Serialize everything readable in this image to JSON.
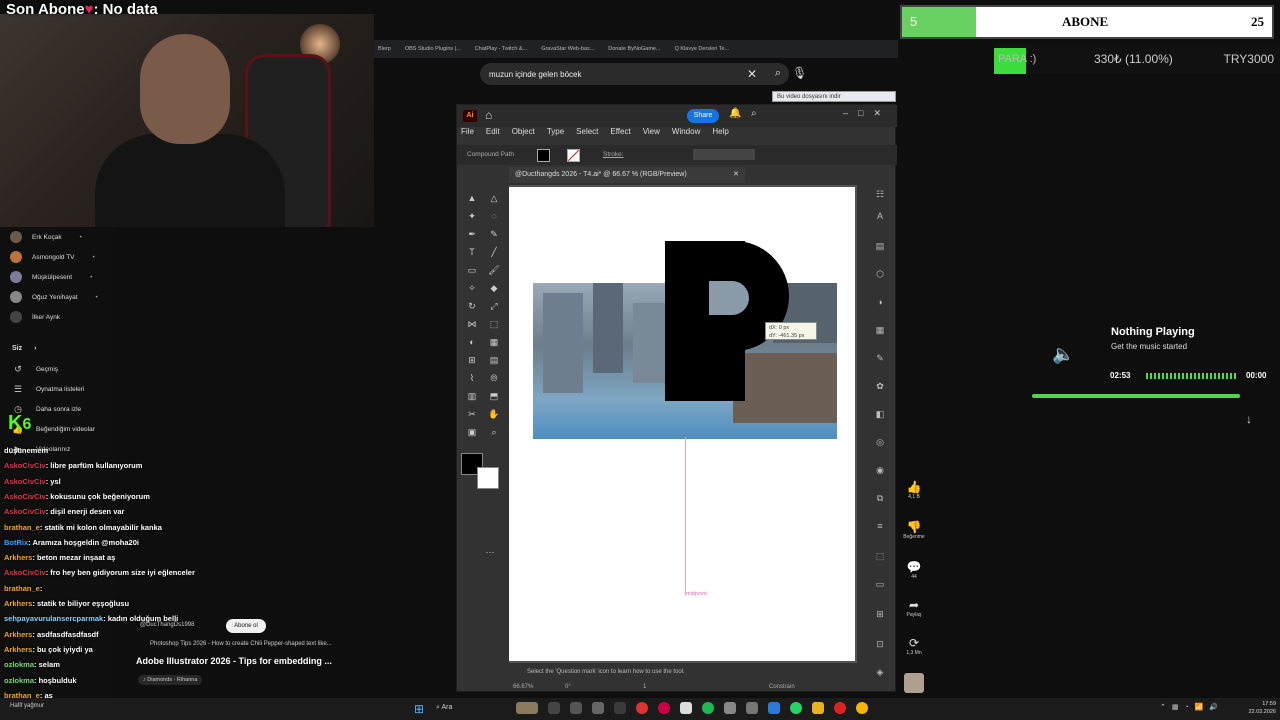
{
  "stream": {
    "title_prefix": "Son Abone",
    "title_suffix": ": No data",
    "sub_goal": {
      "current": "5",
      "label": "ABONE",
      "target": "25",
      "progress": 0.2
    },
    "para": {
      "tag": "PARA :)",
      "value": "330₺ (11.00%)",
      "try": "TRY3000"
    }
  },
  "browser": {
    "bookmarks": [
      "Blerp",
      "OBS Studio Plugins |...",
      "ChatPlay - Twitch &...",
      "GravaStar Web-bas...",
      "Donate ByNoGame...",
      "Q Klavye Dersleri Te..."
    ],
    "search_query": "muzun içinde gelen böcek",
    "download_banner": "Bu video dosyasını indir"
  },
  "sidebar": {
    "subscriptions": [
      "Erk Koçak",
      "Asmongold TV",
      "Müşkülpesent",
      "Oğuz Yenihayat",
      "İlker Aynk"
    ],
    "you_label": "Siz",
    "nav": [
      "Geçmiş",
      "Oynatma listeleri",
      "Daha sonra izle",
      "Beğendiğim videolar",
      "Videolarınız"
    ],
    "k_logo": "K",
    "k_number": "6"
  },
  "chat": [
    {
      "user": "düşünemem",
      "msg": "",
      "color": "#ffffff"
    },
    {
      "user": "AskoCivCiv",
      "msg": ": libre parfüm kullanıyorum",
      "color": "#e8344a"
    },
    {
      "user": "AskoCivCiv",
      "msg": ": ysl",
      "color": "#e8344a"
    },
    {
      "user": "AskoCivCiv",
      "msg": ": kokusunu çok beğeniyorum",
      "color": "#e8344a"
    },
    {
      "user": "AskoCivCiv",
      "msg": ": dişil enerji desen var",
      "color": "#e8344a"
    },
    {
      "user": "brathan_e",
      "msg": ": statik mi kolon olmayabilir kanka",
      "color": "#f5a623"
    },
    {
      "user": "BotRix",
      "msg": ": Aramıza hoşgeldin @moha20i",
      "color": "#3da5ff"
    },
    {
      "user": "Arkhers",
      "msg": ": beton mezar inşaat aş",
      "color": "#f5a623"
    },
    {
      "user": "AskoCivCiv",
      "msg": ": fro hey ben gidiyorum size iyi eğlenceler",
      "color": "#e8344a"
    },
    {
      "user": "brathan_e",
      "msg": ":",
      "color": "#f5a623"
    },
    {
      "user": "Arkhers",
      "msg": ": statik te biliyor eşşoğlusu",
      "color": "#f5a623"
    },
    {
      "user": "sehpayavurulansercparmak",
      "msg": ": kadın olduğum belli",
      "color": "#7fd4ff"
    },
    {
      "user": "Arkhers",
      "msg": ": asdfasdfasdfasdf",
      "color": "#f5a623"
    },
    {
      "user": "Arkhers",
      "msg": ": bu çok iyiydi ya",
      "color": "#f5a623"
    },
    {
      "user": "ozlokma",
      "msg": ": selam",
      "color": "#6fe06f"
    },
    {
      "user": "ozlokma",
      "msg": ": hoşbulduk",
      "color": "#6fe06f"
    },
    {
      "user": "brathan_e",
      "msg": ": as",
      "color": "#f5a623"
    },
    {
      "user": "brathan_e",
      "msg": ":",
      "color": "#f5a623"
    }
  ],
  "youtube": {
    "channel": "@DucThangDs1998",
    "subscribe": "Abone ol",
    "video_line": "Photoshop Tips 2026 - How to create Chili Pepper-shaped text like...",
    "title": "Adobe Illustrator 2026 - Tips for embedding ...",
    "music": "Diamonds · Rihanna",
    "likes": "4,1 B",
    "dislike_label": "Beğenme",
    "comments": "44",
    "share_label": "Paylaş",
    "remix_count": "1,3 Mn"
  },
  "illustrator": {
    "logo": "Ai",
    "share": "Share",
    "menu": [
      "File",
      "Edit",
      "Object",
      "Type",
      "Select",
      "Effect",
      "View",
      "Window",
      "Help"
    ],
    "control_label": "Compound Path",
    "stroke_label": "Stroke:",
    "doc_tab": "@Ducthangds 2026 - T4.ai* @ 66.67 % (RGB/Preview)",
    "tooltip_dx": "dX: 0 px",
    "tooltip_dy": "dY: -461.35 px",
    "midpoint": "midpoint",
    "status": "Select the 'Question mark' icon to learn how to use the tool.",
    "zoom": "66.67%",
    "angle": "0°",
    "page": "1",
    "constrain": "Constrain"
  },
  "music": {
    "title": "Nothing Playing",
    "subtitle": "Get the music started",
    "time_left": "02:53",
    "time_right": "00:00"
  },
  "taskbar": {
    "search": "Ara",
    "weather": "Hafif yağmur",
    "time": "17:59",
    "date": "22.03.2026"
  }
}
